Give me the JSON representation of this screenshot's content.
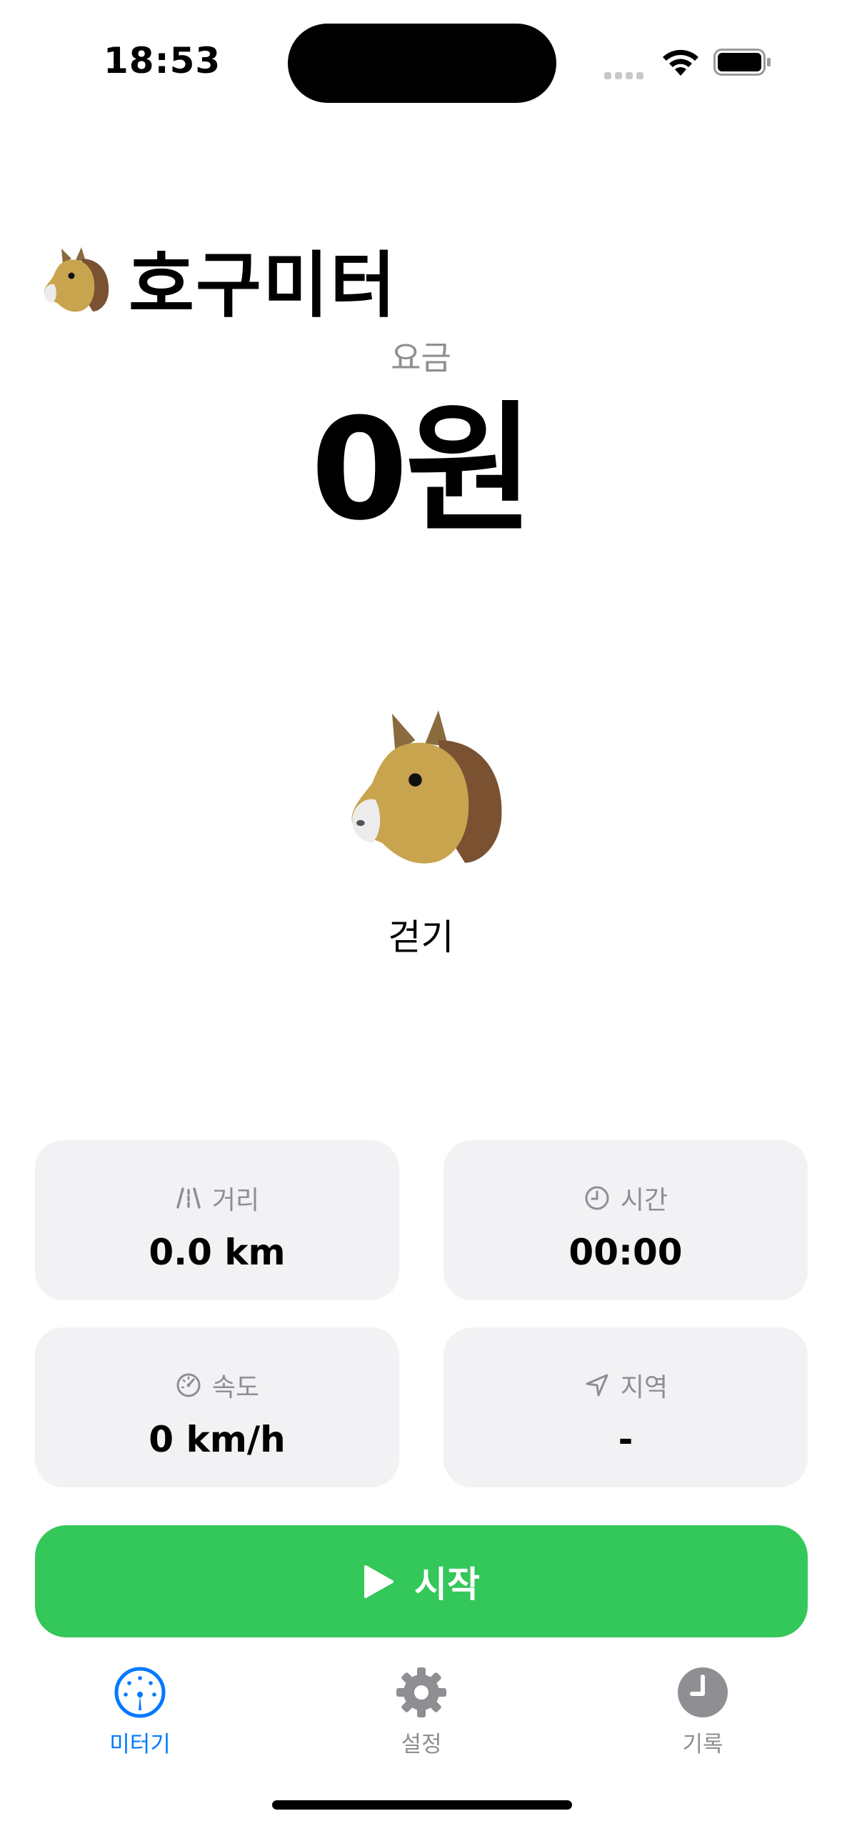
{
  "status_bar": {
    "time": "18:53"
  },
  "header": {
    "title": "호구미터"
  },
  "fare": {
    "label": "요금",
    "value": "0원"
  },
  "mode": {
    "label": "걷기"
  },
  "stats": [
    {
      "icon": "road-icon",
      "label": "거리",
      "value": "0.0 km"
    },
    {
      "icon": "clock-icon",
      "label": "시간",
      "value": "00:00"
    },
    {
      "icon": "speedometer-icon",
      "label": "속도",
      "value": "0 km/h"
    },
    {
      "icon": "location-arrow-icon",
      "label": "지역",
      "value": "-"
    }
  ],
  "start_button": {
    "label": "시작"
  },
  "tabs": [
    {
      "label": "미터기",
      "icon": "gauge-icon",
      "active": true
    },
    {
      "label": "설정",
      "icon": "gear-icon",
      "active": false
    },
    {
      "label": "기록",
      "icon": "clock-icon",
      "active": false
    }
  ],
  "colors": {
    "accent": "#007aff",
    "start_green": "#34c759",
    "inactive": "#8e8e93",
    "card_bg": "#f2f2f4"
  }
}
